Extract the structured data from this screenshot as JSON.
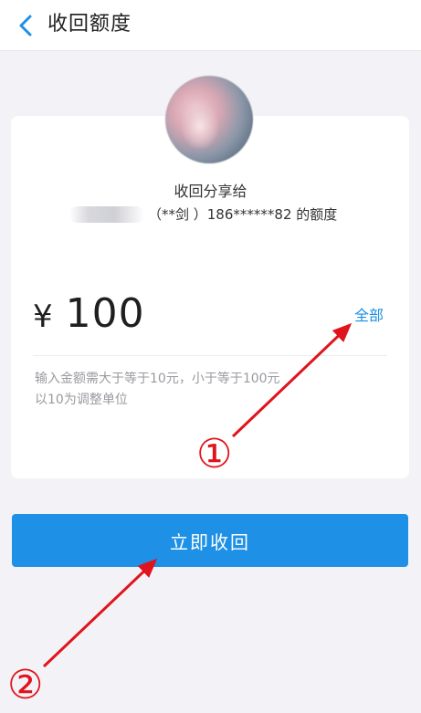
{
  "header": {
    "back_icon": "chevron-left-icon",
    "title": "收回额度"
  },
  "card": {
    "avatar_icon": "user-avatar",
    "share_label": "收回分享给",
    "recipient": "（**剑 ）186******82 的额度",
    "currency": "¥",
    "amount": "100",
    "all_label": "全部",
    "hint_line1": "输入金额需大于等于10元，小于等于100元",
    "hint_line2": "以10为调整单位"
  },
  "actions": {
    "confirm_label": "立即收回"
  },
  "annotations": {
    "step1": "①",
    "step2": "②",
    "arrow_color": "#e0141c"
  },
  "colors": {
    "accent": "#1e90e6",
    "link": "#1a8fe3",
    "background": "#f3f3f7"
  }
}
